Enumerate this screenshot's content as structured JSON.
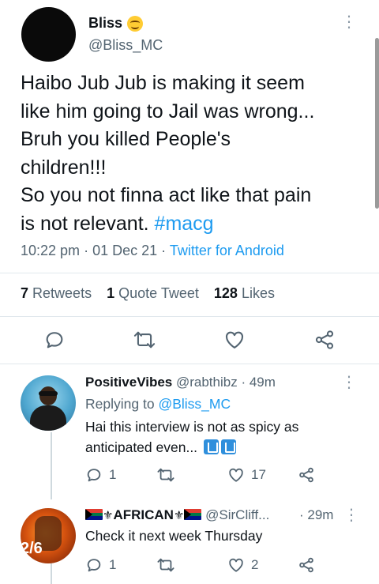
{
  "tweet": {
    "display_name": "Bliss",
    "handle": "@Bliss_MC",
    "text_lines": [
      "Haibo Jub Jub is making it seem",
      "like him going to Jail was wrong...",
      "Bruh you killed People's",
      "children!!!",
      "So you not finna act like that pain",
      "is not relevant."
    ],
    "hashtag": "#macg",
    "time": "10:22 pm",
    "date": "01 Dec 21",
    "source": "Twitter for Android",
    "separator": "·"
  },
  "stats": {
    "retweets_count": "7",
    "retweets_label": "Retweets",
    "quotes_count": "1",
    "quotes_label": "Quote Tweet",
    "likes_count": "128",
    "likes_label": "Likes"
  },
  "replies": [
    {
      "display_name": "PositiveVibes",
      "handle": "@rabthibz",
      "time": "· 49m",
      "replying_prefix": "Replying to",
      "replying_handle": "@Bliss_MC",
      "text_line1": "Hai this interview is not as spicy as",
      "text_line2": "anticipated even...",
      "reply_count": "1",
      "retweet_count": "",
      "like_count": "17"
    },
    {
      "display_name": "AFRICAN",
      "handle": "@SirCliff...",
      "time": "· 29m",
      "avatar_badge": "2/6",
      "text": "Check it next week Thursday",
      "reply_count": "1",
      "retweet_count": "",
      "like_count": "2"
    }
  ],
  "colors": {
    "link": "#1d9bf0",
    "secondary_text": "#536471",
    "primary_text": "#0f1419",
    "divider": "#e1e8ed"
  }
}
